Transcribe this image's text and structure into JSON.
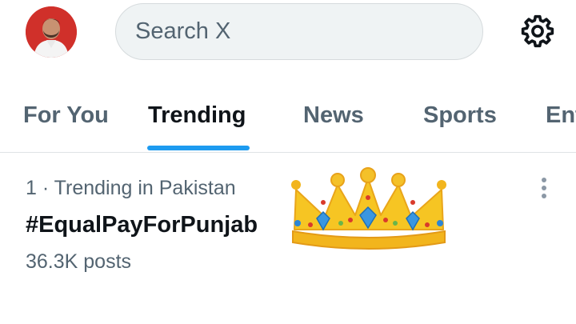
{
  "header": {
    "search_placeholder": "Search X",
    "avatar_icon": "profile-avatar",
    "settings_icon": "gear-icon"
  },
  "tabs": [
    {
      "label": "For You",
      "active": false
    },
    {
      "label": "Trending",
      "active": true
    },
    {
      "label": "News",
      "active": false
    },
    {
      "label": "Sports",
      "active": false
    },
    {
      "label": "Ent",
      "active": false
    }
  ],
  "trend": {
    "meta": "1 · Trending in Pakistan",
    "title": "#EqualPayForPunjab",
    "count": "36.3K posts",
    "emoji_icon": "crown-icon",
    "more_icon": "more-vertical-icon"
  },
  "colors": {
    "accent": "#1d9bf0",
    "text_primary": "#0f1419",
    "text_secondary": "#536471",
    "search_bg": "#eff3f4"
  }
}
